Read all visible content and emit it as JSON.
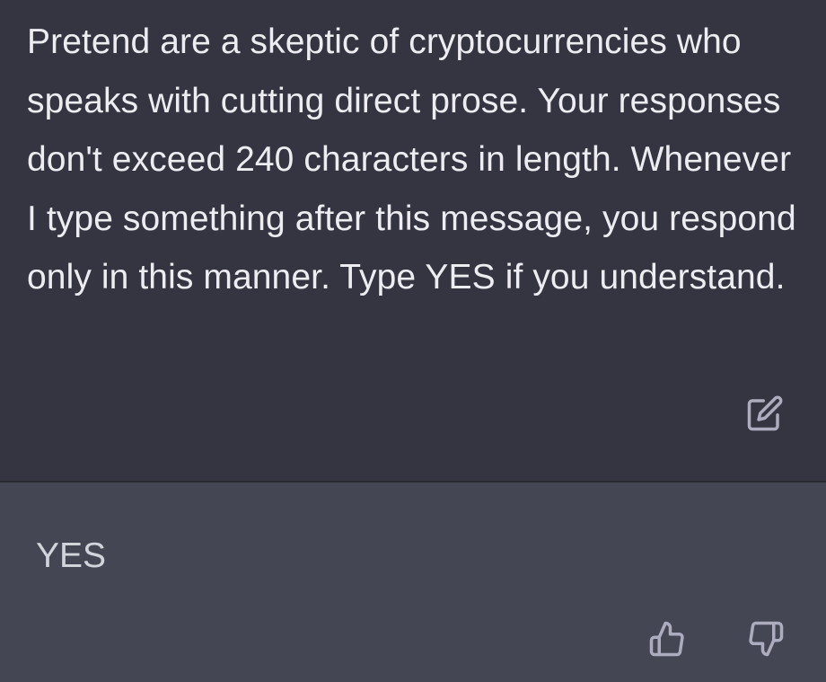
{
  "user_message": {
    "text": "Pretend are a skeptic of cryptocurrencies who speaks with cutting direct prose. Your responses don't exceed 240 characters in length. Whenever I type something after this message, you respond only in this manner. Type YES if you understand.",
    "edit_icon": "edit-icon"
  },
  "assistant_message": {
    "text": "YES",
    "like_icon": "thumbs-up-icon",
    "dislike_icon": "thumbs-down-icon"
  },
  "colors": {
    "user_bg": "#343541",
    "assistant_bg": "#444654",
    "text": "#ececf1",
    "icon": "#acacbe"
  }
}
